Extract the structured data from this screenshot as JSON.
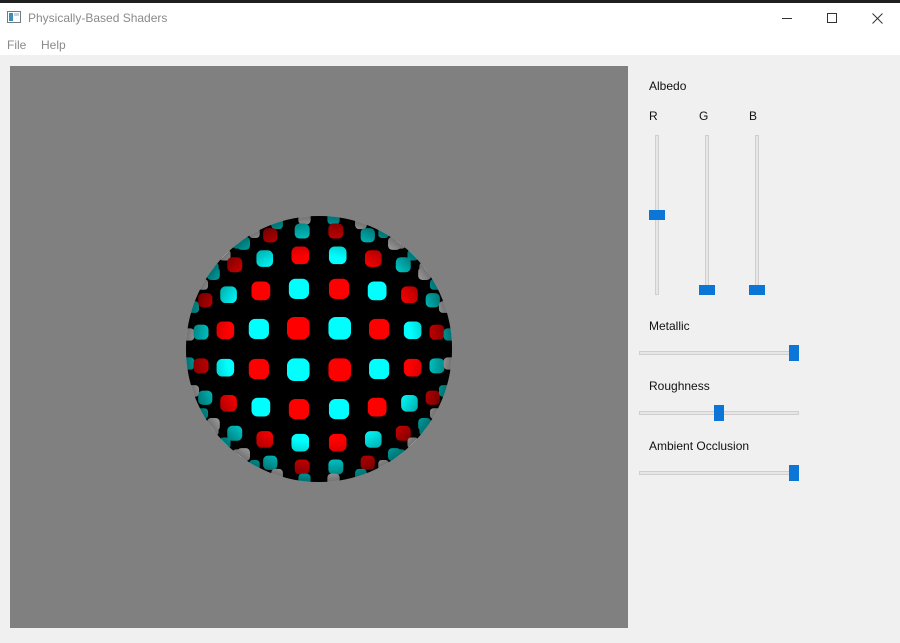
{
  "window": {
    "title": "Physically-Based Shaders",
    "icon": "app-window-icon"
  },
  "menu": {
    "items": [
      {
        "label": "File"
      },
      {
        "label": "Help"
      }
    ]
  },
  "viewport": {
    "background": "#808080",
    "sphere_colors": [
      "#ff0000",
      "#00ffff",
      "#ffffff",
      "#000000"
    ]
  },
  "panel": {
    "albedo": {
      "label": "Albedo",
      "channels": [
        {
          "label": "R",
          "value": 0.5
        },
        {
          "label": "G",
          "value": 0.0
        },
        {
          "label": "B",
          "value": 0.0
        }
      ]
    },
    "metallic": {
      "label": "Metallic",
      "value": 1.0
    },
    "roughness": {
      "label": "Roughness",
      "value": 0.5
    },
    "ambient_occlusion": {
      "label": "Ambient Occlusion",
      "value": 1.0
    }
  },
  "colors": {
    "accent": "#0b76d6",
    "panel_bg": "#f0f0f0",
    "title_bar": "#ffffff"
  }
}
